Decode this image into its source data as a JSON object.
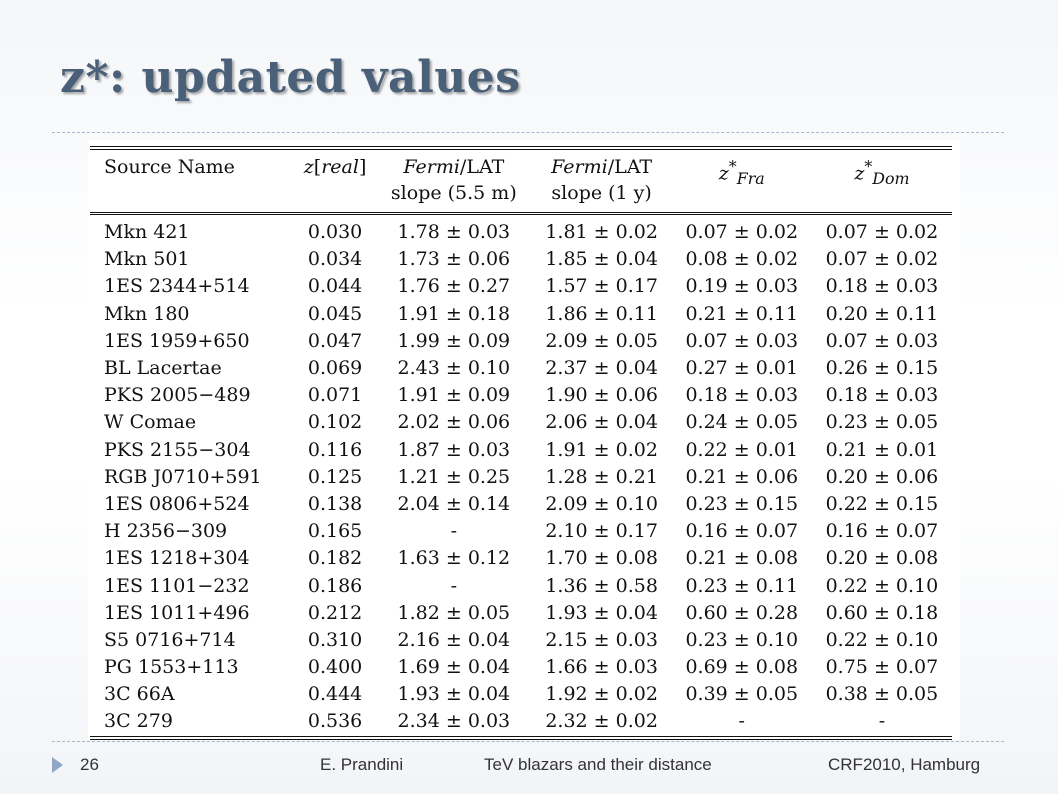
{
  "slide": {
    "title": "z*: updated values",
    "page_number": "26",
    "author": "E. Prandini",
    "talk_title": "TeV blazars and their distance",
    "event": "CRF2010,  Hamburg"
  },
  "table": {
    "headers": {
      "source": "Source Name",
      "z_prefix": "z[",
      "z_word": "real",
      "z_suffix": "]",
      "fermi1_a": "Fermi",
      "fermi1_b": "/LAT",
      "fermi1_sub": "slope (5.5 m)",
      "fermi2_a": "Fermi",
      "fermi2_b": "/LAT",
      "fermi2_sub": "slope (1 y)",
      "zfra_base": "z",
      "zfra_sup": "*",
      "zfra_sub": "Fra",
      "zdom_base": "z",
      "zdom_sup": "*",
      "zdom_sub": "Dom"
    },
    "rows": [
      [
        "Mkn 421",
        "0.030",
        "1.78 ± 0.03",
        "1.81 ± 0.02",
        "0.07 ± 0.02",
        "0.07 ± 0.02"
      ],
      [
        "Mkn 501",
        "0.034",
        "1.73 ± 0.06",
        "1.85 ± 0.04",
        "0.08 ± 0.02",
        "0.07 ± 0.02"
      ],
      [
        "1ES 2344+514",
        "0.044",
        "1.76 ± 0.27",
        "1.57 ± 0.17",
        "0.19 ± 0.03",
        "0.18 ± 0.03"
      ],
      [
        "Mkn 180",
        "0.045",
        "1.91 ± 0.18",
        "1.86 ± 0.11",
        "0.21 ± 0.11",
        "0.20 ± 0.11"
      ],
      [
        "1ES 1959+650",
        "0.047",
        "1.99 ± 0.09",
        "2.09 ± 0.05",
        "0.07 ± 0.03",
        "0.07 ± 0.03"
      ],
      [
        "BL Lacertae",
        "0.069",
        "2.43 ± 0.10",
        "2.37 ± 0.04",
        "0.27 ± 0.01",
        "0.26 ± 0.15"
      ],
      [
        "PKS 2005−489",
        "0.071",
        "1.91 ± 0.09",
        "1.90 ± 0.06",
        "0.18 ± 0.03",
        "0.18 ± 0.03"
      ],
      [
        "W Comae",
        "0.102",
        "2.02 ± 0.06",
        "2.06 ± 0.04",
        "0.24 ± 0.05",
        "0.23 ± 0.05"
      ],
      [
        "PKS 2155−304",
        "0.116",
        "1.87 ± 0.03",
        "1.91 ± 0.02",
        "0.22 ± 0.01",
        "0.21 ± 0.01"
      ],
      [
        "RGB J0710+591",
        "0.125",
        "1.21 ± 0.25",
        "1.28 ± 0.21",
        "0.21 ± 0.06",
        "0.20 ± 0.06"
      ],
      [
        "1ES 0806+524",
        "0.138",
        "2.04 ± 0.14",
        "2.09 ± 0.10",
        "0.23 ± 0.15",
        "0.22 ± 0.15"
      ],
      [
        "H 2356−309",
        "0.165",
        "-",
        "2.10 ± 0.17",
        "0.16 ± 0.07",
        "0.16 ± 0.07"
      ],
      [
        "1ES 1218+304",
        "0.182",
        "1.63 ± 0.12",
        "1.70 ± 0.08",
        "0.21 ± 0.08",
        "0.20 ± 0.08"
      ],
      [
        "1ES 1101−232",
        "0.186",
        "-",
        "1.36 ± 0.58",
        "0.23 ± 0.11",
        "0.22 ± 0.10"
      ],
      [
        "1ES 1011+496",
        "0.212",
        "1.82 ± 0.05",
        "1.93 ± 0.04",
        "0.60 ± 0.28",
        "0.60 ± 0.18"
      ],
      [
        "S5 0716+714",
        "0.310",
        "2.16 ± 0.04",
        "2.15 ± 0.03",
        "0.23 ± 0.10",
        "0.22 ± 0.10"
      ],
      [
        "PG 1553+113",
        "0.400",
        "1.69 ± 0.04",
        "1.66 ± 0.03",
        "0.69 ± 0.08",
        "0.75 ± 0.07"
      ],
      [
        "3C 66A",
        "0.444",
        "1.93 ± 0.04",
        "1.92 ± 0.02",
        "0.39 ± 0.05",
        "0.38 ± 0.05"
      ],
      [
        "3C 279",
        "0.536",
        "2.34 ± 0.03",
        "2.32 ± 0.02",
        "-",
        "-"
      ]
    ]
  }
}
